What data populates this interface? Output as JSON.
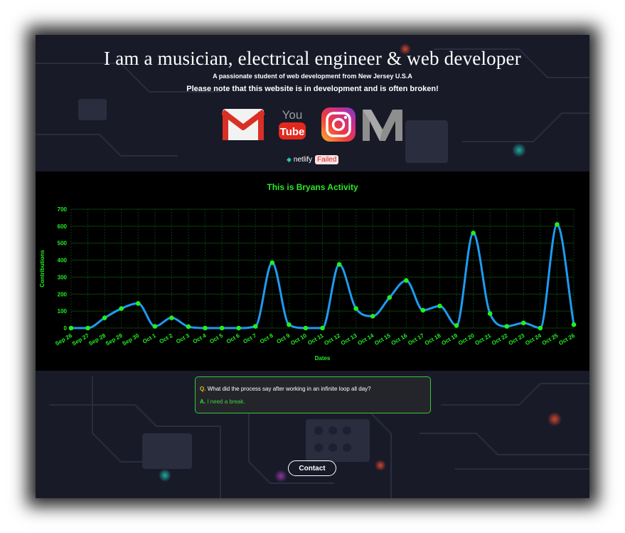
{
  "header": {
    "title": "I am a musician, electrical engineer & web developer",
    "subtitle": "A passionate student of web development from New Jersey U.S.A",
    "notice": "Please note that this website is in development and is often broken!"
  },
  "socials": [
    {
      "name": "gmail",
      "icon": "gmail-icon"
    },
    {
      "name": "youtube",
      "icon": "youtube-icon",
      "label_top": "You",
      "label_bottom": "Tube"
    },
    {
      "name": "instagram",
      "icon": "instagram-icon"
    },
    {
      "name": "medium",
      "icon": "medium-icon"
    }
  ],
  "badge": {
    "provider": "netlify",
    "status": "Failed"
  },
  "chart_data": {
    "type": "line",
    "title": "This is Bryans Activity",
    "xlabel": "Dates",
    "ylabel": "Contributions",
    "ylim": [
      0,
      700
    ],
    "yticks": [
      0,
      100,
      200,
      300,
      400,
      500,
      600,
      700
    ],
    "grid": true,
    "categories": [
      "Sep 26",
      "Sep 27",
      "Sep 28",
      "Sep 29",
      "Sep 30",
      "Oct 1",
      "Oct 2",
      "Oct 3",
      "Oct 4",
      "Oct 5",
      "Oct 6",
      "Oct 7",
      "Oct 8",
      "Oct 9",
      "Oct 10",
      "Oct 11",
      "Oct 12",
      "Oct 13",
      "Oct 14",
      "Oct 15",
      "Oct 16",
      "Oct 17",
      "Oct 18",
      "Oct 19",
      "Oct 20",
      "Oct 21",
      "Oct 22",
      "Oct 23",
      "Oct 24",
      "Oct 25",
      "Oct 26"
    ],
    "series": [
      {
        "values": [
          0,
          0,
          60,
          115,
          145,
          10,
          60,
          8,
          0,
          0,
          0,
          10,
          385,
          20,
          0,
          0,
          375,
          115,
          70,
          180,
          280,
          105,
          130,
          15,
          560,
          85,
          10,
          30,
          0,
          610,
          20
        ]
      }
    ],
    "colors": {
      "line": "#1e9bf0",
      "points": "#22ee22",
      "text": "#22ee22",
      "grid": "#0b3d0b"
    }
  },
  "joke": {
    "q_label": "Q.",
    "question": "What did the process say after working in an infinite loop all day?",
    "a_label": "A.",
    "answer": "I need a break."
  },
  "contact": {
    "label": "Contact"
  }
}
